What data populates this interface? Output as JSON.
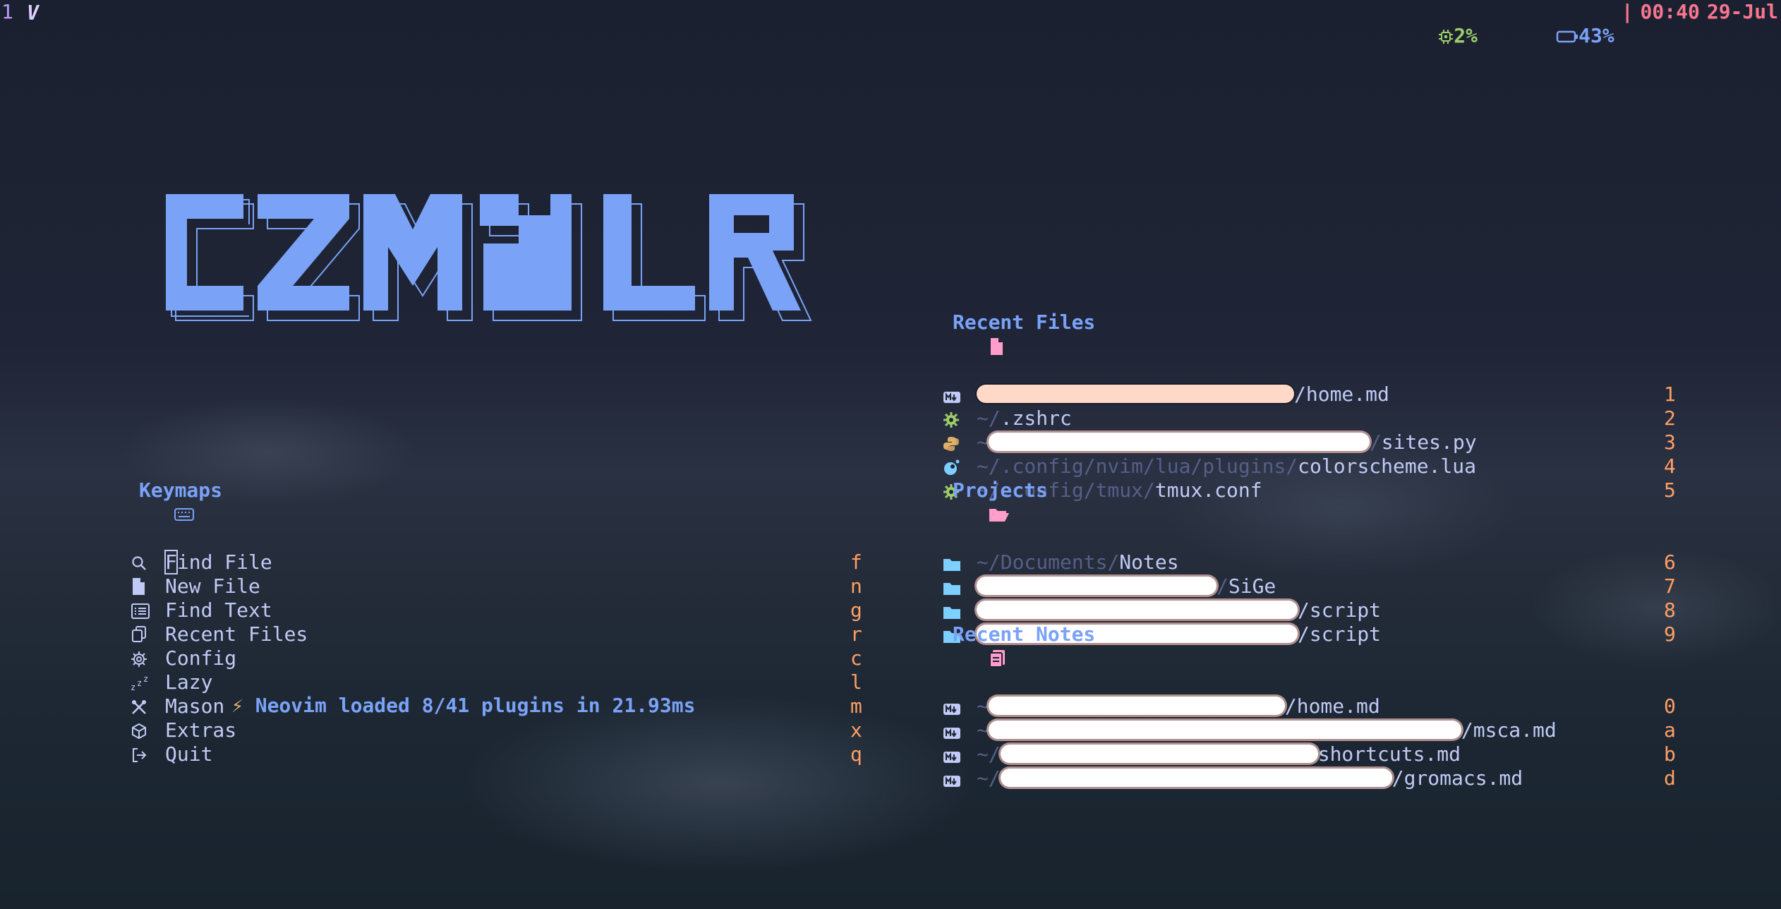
{
  "topbar": {
    "workspace": "1",
    "logo": "V",
    "cpu_icon": "cpu-icon",
    "cpu": "2%",
    "battery_icon": "battery-icon",
    "battery": "43%",
    "separator": "|",
    "time": "00:40",
    "date": "29-Jul"
  },
  "banner": {
    "text": "CZM&LR",
    "color": "#7aa2f7"
  },
  "keymaps": {
    "title": "Keymaps",
    "icon": "keyboard-icon",
    "items": [
      {
        "label": "Find File",
        "key": "f",
        "icon": "search-icon"
      },
      {
        "label": "New File",
        "key": "n",
        "icon": "file-icon"
      },
      {
        "label": "Find Text",
        "key": "g",
        "icon": "list-icon"
      },
      {
        "label": "Recent Files",
        "key": "r",
        "icon": "copy-icon"
      },
      {
        "label": "Config",
        "key": "c",
        "icon": "gear-icon"
      },
      {
        "label": "Lazy",
        "key": "l",
        "icon": "sleep-icon"
      },
      {
        "label": "Mason",
        "key": "m",
        "icon": "tools-icon"
      },
      {
        "label": "Extras",
        "key": "x",
        "icon": "box-icon"
      },
      {
        "label": "Quit",
        "key": "q",
        "icon": "exit-icon"
      }
    ]
  },
  "recent_files": {
    "title": "Recent Files",
    "icon": "file-icon",
    "items": [
      {
        "prefix": "",
        "path": "",
        "name": "/home.md",
        "key": "1",
        "icon": "markdown-icon",
        "redacted": true
      },
      {
        "prefix": "~/",
        "path": "",
        "name": ".zshrc",
        "key": "2",
        "icon": "gear-icon",
        "redacted": false
      },
      {
        "prefix": "~",
        "path": "/",
        "name": "sites.py",
        "key": "3",
        "icon": "python-icon",
        "redacted": true
      },
      {
        "prefix": "~/",
        "path": ".config/nvim/lua/plugins/",
        "name": "colorscheme.lua",
        "key": "4",
        "icon": "lua-icon",
        "redacted": false
      },
      {
        "prefix": "~/",
        "path": ".config/tmux/",
        "name": "tmux.conf",
        "key": "5",
        "icon": "gear-icon",
        "redacted": false
      }
    ]
  },
  "projects": {
    "title": "Projects",
    "icon": "folder-open-icon",
    "items": [
      {
        "prefix": "~/",
        "path": "Documents/",
        "name": "Notes",
        "key": "6",
        "redacted": false
      },
      {
        "prefix": "",
        "path": "/",
        "name": "SiGe",
        "key": "7",
        "redacted": true
      },
      {
        "prefix": "",
        "path": "",
        "name": "/script",
        "key": "8",
        "redacted": true
      },
      {
        "prefix": "",
        "path": "",
        "name": "/script",
        "key": "9",
        "redacted": true
      }
    ]
  },
  "recent_notes": {
    "title": "Recent Notes",
    "icon": "notes-icon",
    "items": [
      {
        "prefix": "~",
        "name": "/home.md",
        "key": "0"
      },
      {
        "prefix": "~",
        "name": "/msca.md",
        "key": "a"
      },
      {
        "prefix": "~/",
        "name": "shortcuts.md",
        "key": "b"
      },
      {
        "prefix": "~/",
        "name": "/gromacs.md",
        "key": "d"
      }
    ]
  },
  "footer": {
    "prefix": "Neovim loaded ",
    "plugins": "8/41",
    "middle": " plugins in ",
    "time": "21.93ms"
  }
}
